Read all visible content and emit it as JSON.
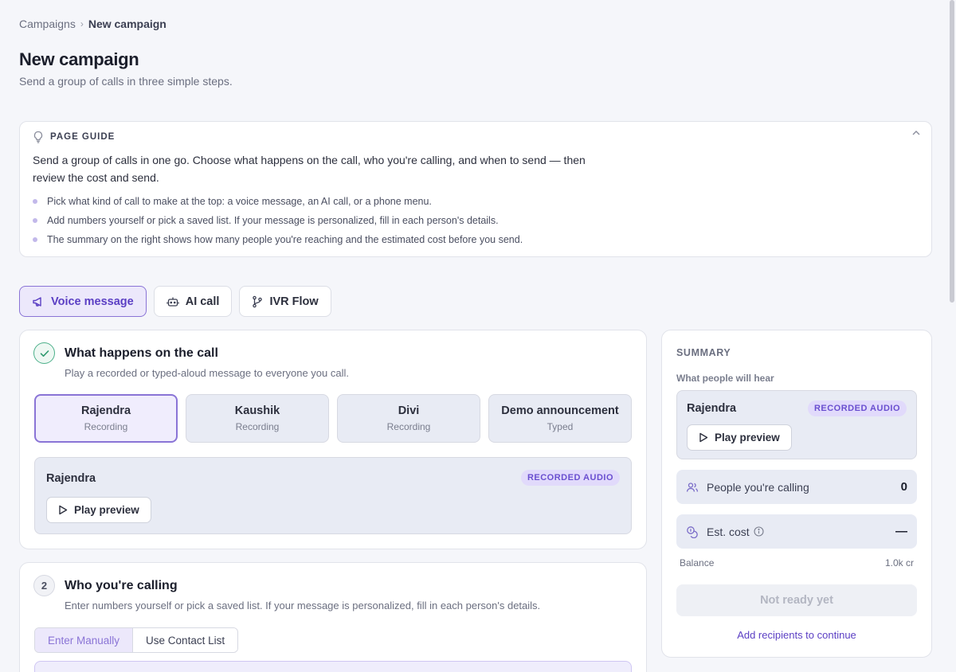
{
  "breadcrumb": {
    "parent": "Campaigns",
    "separator": "›",
    "current": "New campaign"
  },
  "page": {
    "title": "New campaign",
    "subtitle": "Send a group of calls in three simple steps."
  },
  "guide": {
    "title": "PAGE GUIDE",
    "intro": "Send a group of calls in one go. Choose what happens on the call, who you're calling, and when to send — then review the cost and send.",
    "items": [
      "Pick what kind of call to make at the top: a voice message, an AI call, or a phone menu.",
      "Add numbers yourself or pick a saved list. If your message is personalized, fill in each person's details.",
      "The summary on the right shows how many people you're reaching and the estimated cost before you send."
    ]
  },
  "mode_tabs": [
    {
      "label": "Voice message",
      "icon": "megaphone-icon",
      "active": true
    },
    {
      "label": "AI call",
      "icon": "robot-icon",
      "active": false
    },
    {
      "label": "IVR Flow",
      "icon": "branch-icon",
      "active": false
    }
  ],
  "step1": {
    "title": "What happens on the call",
    "description": "Play a recorded or typed-aloud message to everyone you call.",
    "options": [
      {
        "name": "Rajendra",
        "kind": "Recording",
        "selected": true
      },
      {
        "name": "Kaushik",
        "kind": "Recording",
        "selected": false
      },
      {
        "name": "Divi",
        "kind": "Recording",
        "selected": false
      },
      {
        "name": "Demo announcement",
        "kind": "Typed",
        "selected": false
      }
    ],
    "preview": {
      "name": "Rajendra",
      "badge": "RECORDED AUDIO",
      "play_label": "Play preview"
    }
  },
  "step2": {
    "number": "2",
    "title": "Who you're calling",
    "description": "Enter numbers yourself or pick a saved list. If your message is personalized, fill in each person's details.",
    "segments": [
      {
        "label": "Enter Manually",
        "active": true
      },
      {
        "label": "Use Contact List",
        "active": false
      }
    ]
  },
  "summary": {
    "title": "SUMMARY",
    "hear_label": "What people will hear",
    "preview": {
      "name": "Rajendra",
      "badge": "RECORDED AUDIO",
      "play_label": "Play preview"
    },
    "people_label": "People you're calling",
    "people_value": "0",
    "cost_label": "Est. cost",
    "cost_value": "—",
    "balance_label": "Balance",
    "balance_value": "1.0k cr",
    "send_label": "Not ready yet",
    "hint": "Add recipients to continue"
  },
  "colors": {
    "accent": "#5b3fc4",
    "accent_soft": "#ece8fb",
    "success": "#2e9a6e",
    "surface": "#e8ebf4"
  }
}
